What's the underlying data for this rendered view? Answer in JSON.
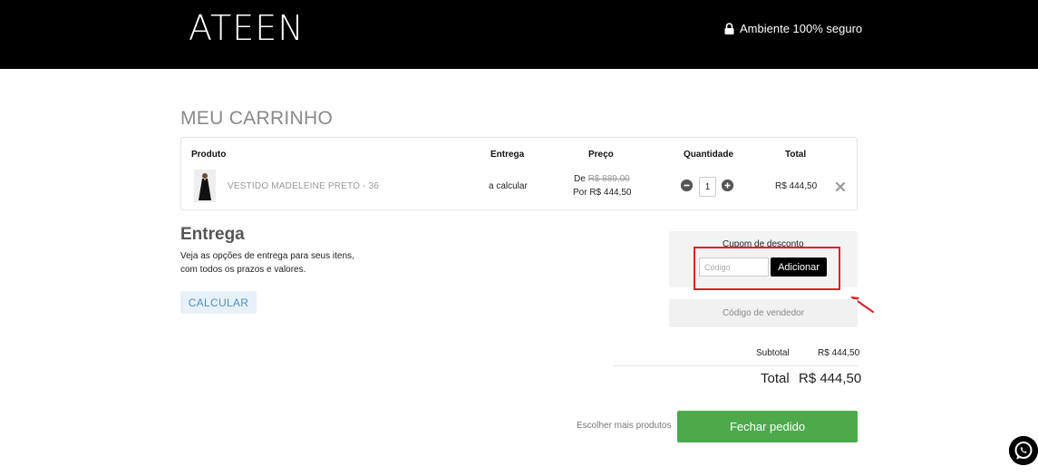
{
  "header": {
    "logo": "ATEEN",
    "secure_text": "Ambiente 100% seguro",
    "secure_icon": "lock-icon"
  },
  "cart": {
    "title": "MEU CARRINHO",
    "columns": {
      "product": "Produto",
      "delivery": "Entrega",
      "price": "Preço",
      "quantity": "Quantidade",
      "total": "Total"
    },
    "items": [
      {
        "name": "VESTIDO MADELEINE PRETO - 36",
        "delivery": "a calcular",
        "price_from_label": "De",
        "price_from": "R$ 889,00",
        "price_by": "Por R$ 444,50",
        "quantity": "1",
        "total": "R$ 444,50"
      }
    ]
  },
  "shipping": {
    "title": "Entrega",
    "desc_line1": "Veja as opções de entrega para seus itens,",
    "desc_line2": "com todos os prazos e valores.",
    "button": "CALCULAR"
  },
  "coupon": {
    "title": "Cupom de desconto",
    "placeholder": "Código",
    "button": "Adicionar"
  },
  "seller": {
    "button": "Código de vendedor"
  },
  "summary": {
    "subtotal_label": "Subtotal",
    "subtotal_value": "R$ 444,50",
    "total_label": "Total",
    "total_value": "R$ 444,50"
  },
  "actions": {
    "continue_shopping": "Escolher mais produtos",
    "checkout": "Fechar pedido"
  },
  "colors": {
    "header_bg": "#000000",
    "checkout_green": "#4caa4c",
    "highlight_red": "#e0202a",
    "calc_button_text": "#4a90c8"
  }
}
